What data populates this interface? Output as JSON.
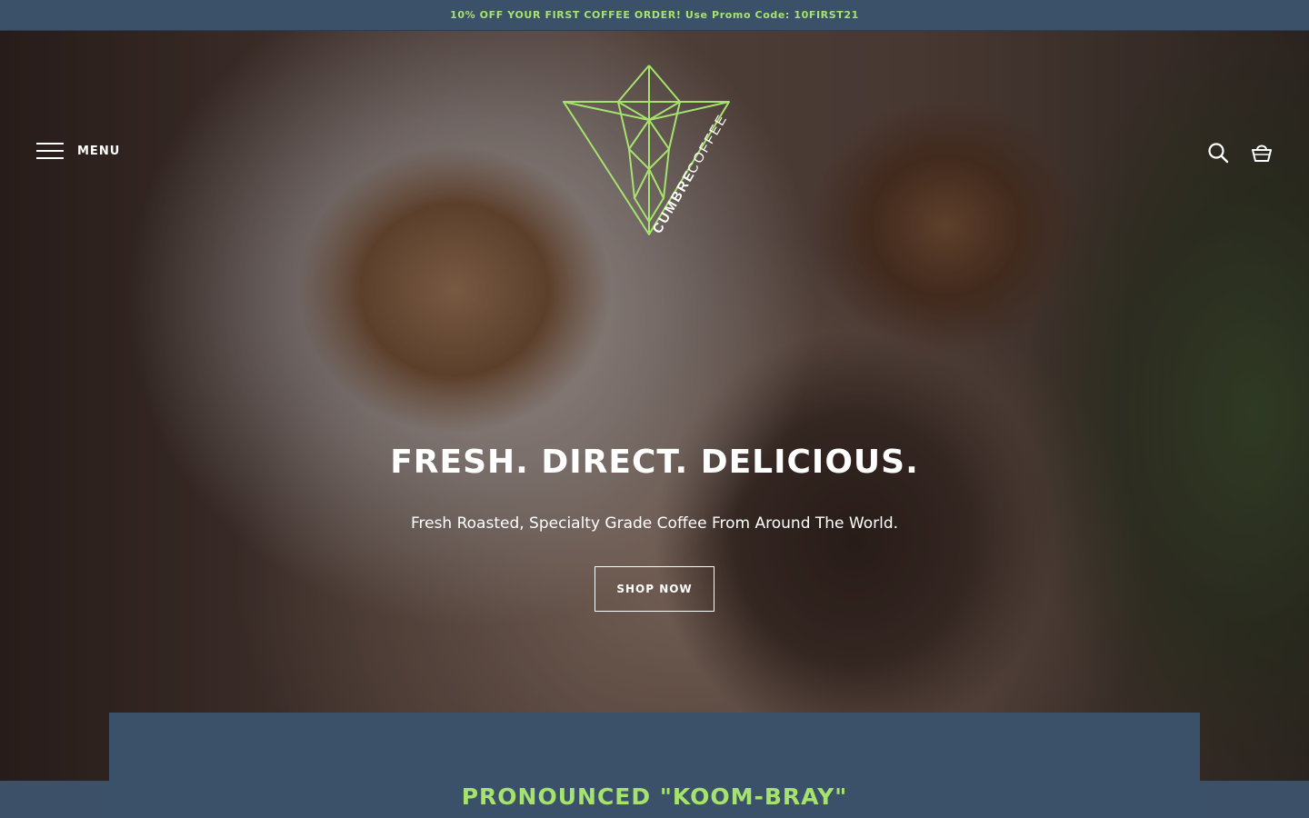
{
  "announcement": {
    "text": "10% OFF YOUR FIRST COFFEE ORDER! Use Promo Code: 10FIRST21"
  },
  "header": {
    "menu_label": "MENU",
    "logo": {
      "icon": "cumbre-coffee-logo",
      "text_bold": "CUMBRE",
      "text_light": "COFFEE"
    },
    "icons": [
      "search-icon",
      "cart-icon"
    ]
  },
  "hero": {
    "title": "FRESH. DIRECT. DELICIOUS.",
    "subtitle": "Fresh Roasted, Specialty Grade Coffee From Around The World.",
    "cta_label": "SHOP NOW"
  },
  "intro": {
    "heading": "PRONOUNCED \"KOOM-BRAY\""
  },
  "colors": {
    "accent": "#a6e36e",
    "navy": "#3b5169",
    "text_on_image": "#ffffff"
  }
}
